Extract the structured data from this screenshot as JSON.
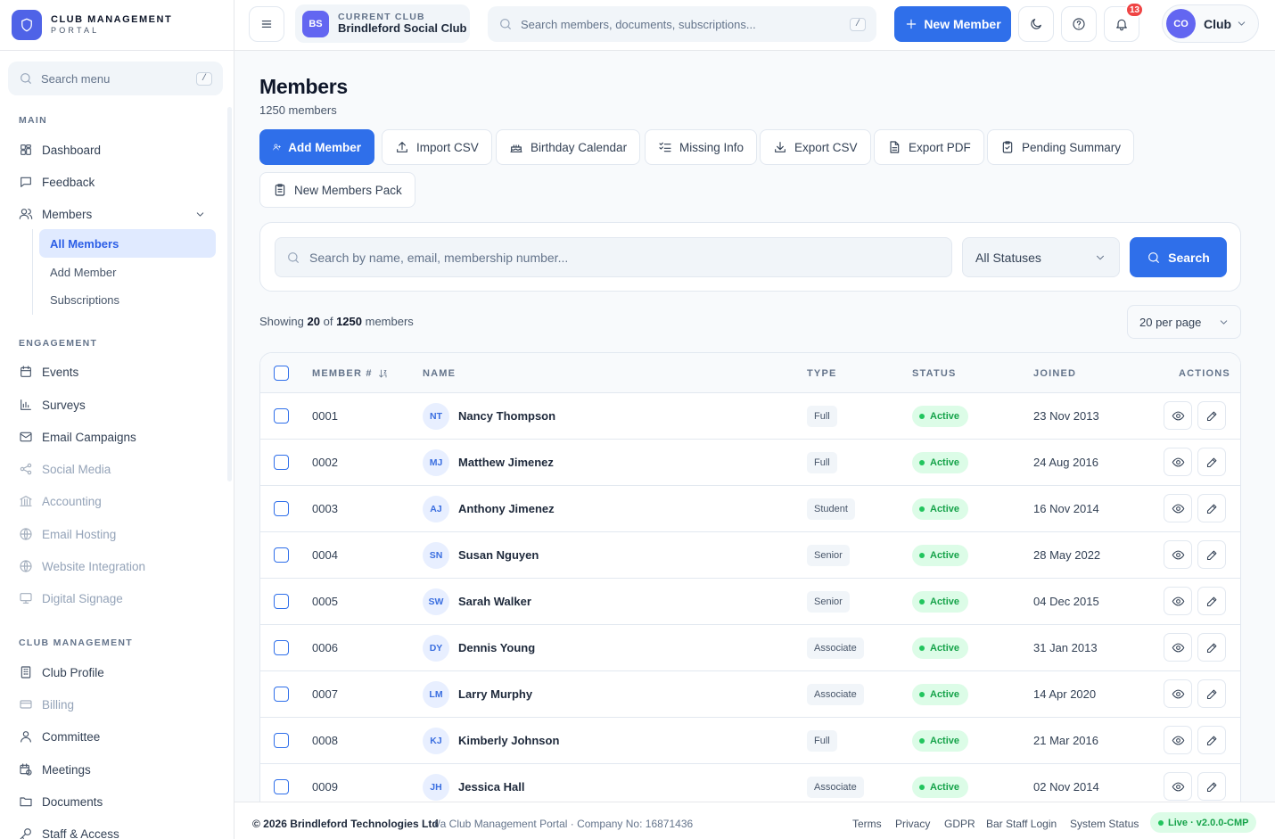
{
  "brand": {
    "line1": "CLUB MANAGEMENT",
    "line2": "PORTAL"
  },
  "sidebar": {
    "search_placeholder": "Search menu",
    "search_kbd": "/",
    "sections": [
      "MAIN",
      "ENGAGEMENT",
      "CLUB MANAGEMENT"
    ],
    "main_items": [
      {
        "label": "Dashboard",
        "icon": "dashboard-icon"
      },
      {
        "label": "Feedback",
        "icon": "message-icon"
      },
      {
        "label": "Members",
        "icon": "users-icon"
      }
    ],
    "members_sub": [
      "All Members",
      "Add Member",
      "Subscriptions"
    ],
    "engagement_items": [
      {
        "label": "Events",
        "icon": "calendar-icon"
      },
      {
        "label": "Surveys",
        "icon": "bar-chart-icon"
      },
      {
        "label": "Email Campaigns",
        "icon": "mail-icon"
      },
      {
        "label": "Social Media",
        "icon": "share-icon"
      },
      {
        "label": "Accounting",
        "icon": "bank-icon"
      },
      {
        "label": "Email Hosting",
        "icon": "globe-icon"
      },
      {
        "label": "Website Integration",
        "icon": "globe-icon"
      },
      {
        "label": "Digital Signage",
        "icon": "monitor-icon"
      }
    ],
    "club_items": [
      {
        "label": "Club Profile",
        "icon": "building-icon"
      },
      {
        "label": "Billing",
        "icon": "card-icon"
      },
      {
        "label": "Committee",
        "icon": "user-icon"
      },
      {
        "label": "Meetings",
        "icon": "calendar-clock-icon"
      },
      {
        "label": "Documents",
        "icon": "folder-icon"
      },
      {
        "label": "Staff & Access",
        "icon": "key-icon"
      }
    ]
  },
  "topbar": {
    "club_badge": "BS",
    "club_label": "CURRENT CLUB",
    "club_name": "Brindleford Social Club",
    "search_placeholder": "Search members, documents, subscriptions...",
    "search_kbd": "/",
    "new_member": "New Member",
    "notifications": "13",
    "user_initials": "CO",
    "user_name": "Club"
  },
  "main": {
    "title": "Members",
    "count_text": "1250 members",
    "actions": [
      "Add Member",
      "Import CSV",
      "Birthday Calendar",
      "Missing Info",
      "Export CSV",
      "Export PDF",
      "Pending Summary",
      "New Members Pack"
    ],
    "filter": {
      "search_placeholder": "Search by name, email, membership number...",
      "status": "All Statuses",
      "search_button": "Search"
    },
    "showing": {
      "prefix": "Showing",
      "shown": "20",
      "of": "of",
      "total": "1250",
      "suffix": "members"
    },
    "per_page": "20 per page",
    "table": {
      "headers": [
        "MEMBER #",
        "NAME",
        "TYPE",
        "STATUS",
        "JOINED",
        "ACTIONS"
      ],
      "rows": [
        {
          "num": "0001",
          "initials": "NT",
          "name": "Nancy Thompson",
          "type": "Full",
          "status": "Active",
          "joined": "23 Nov 2013"
        },
        {
          "num": "0002",
          "initials": "MJ",
          "name": "Matthew Jimenez",
          "type": "Full",
          "status": "Active",
          "joined": "24 Aug 2016"
        },
        {
          "num": "0003",
          "initials": "AJ",
          "name": "Anthony Jimenez",
          "type": "Student",
          "status": "Active",
          "joined": "16 Nov 2014"
        },
        {
          "num": "0004",
          "initials": "SN",
          "name": "Susan Nguyen",
          "type": "Senior",
          "status": "Active",
          "joined": "28 May 2022"
        },
        {
          "num": "0005",
          "initials": "SW",
          "name": "Sarah Walker",
          "type": "Senior",
          "status": "Active",
          "joined": "04 Dec 2015"
        },
        {
          "num": "0006",
          "initials": "DY",
          "name": "Dennis Young",
          "type": "Associate",
          "status": "Active",
          "joined": "31 Jan 2013"
        },
        {
          "num": "0007",
          "initials": "LM",
          "name": "Larry Murphy",
          "type": "Associate",
          "status": "Active",
          "joined": "14 Apr 2020"
        },
        {
          "num": "0008",
          "initials": "KJ",
          "name": "Kimberly Johnson",
          "type": "Full",
          "status": "Active",
          "joined": "21 Mar 2016"
        },
        {
          "num": "0009",
          "initials": "JH",
          "name": "Jessica Hall",
          "type": "Associate",
          "status": "Active",
          "joined": "02 Nov 2014"
        }
      ]
    }
  },
  "footer": {
    "copyright": "© 2026 Brindleford Technologies Ltd",
    "trading": "t/a Club Management Portal · Company No: 16871436",
    "links": [
      "Terms",
      "Privacy",
      "GDPR",
      "Bar Staff Login",
      "System Status"
    ],
    "version": "Live · v2.0.0-CMP"
  },
  "colors": {
    "primary": "#2f6fea",
    "active_green": "#16a34a",
    "badge_red": "#ef4444",
    "avatar_indigo": "#6366f1"
  }
}
